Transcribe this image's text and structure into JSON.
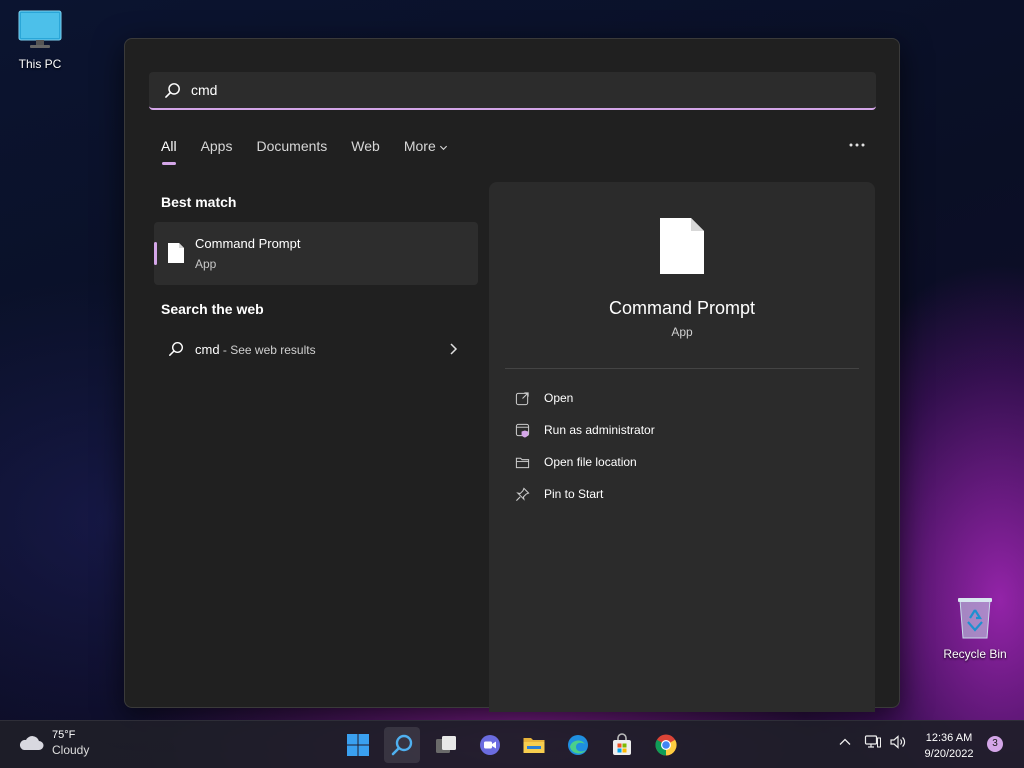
{
  "desktop": {
    "this_pc_label": "This PC",
    "recycle_bin_label": "Recycle Bin"
  },
  "search": {
    "query": "cmd",
    "tabs": [
      {
        "label": "All",
        "active": true
      },
      {
        "label": "Apps"
      },
      {
        "label": "Documents"
      },
      {
        "label": "Web"
      },
      {
        "label": "More"
      }
    ],
    "more_options_icon": "ellipsis-icon"
  },
  "results": {
    "best_match_title": "Best match",
    "best_match": {
      "name": "Command Prompt",
      "type": "App"
    },
    "web_title": "Search the web",
    "web_query": "cmd",
    "web_suffix": " - See web results"
  },
  "preview": {
    "name": "Command Prompt",
    "type": "App",
    "actions": [
      {
        "label": "Open",
        "icon": "open-external-icon"
      },
      {
        "label": "Run as administrator",
        "icon": "shield-admin-icon"
      },
      {
        "label": "Open file location",
        "icon": "folder-icon"
      },
      {
        "label": "Pin to Start",
        "icon": "pin-icon"
      }
    ]
  },
  "taskbar": {
    "weather_temp": "75°F",
    "weather_desc": "Cloudy",
    "clock_time": "12:36 AM",
    "clock_date": "9/20/2022",
    "notification_count": "3"
  },
  "colors": {
    "accent": "#d4a6e8",
    "panel": "#202020",
    "preview_panel": "#2b2b2b"
  }
}
